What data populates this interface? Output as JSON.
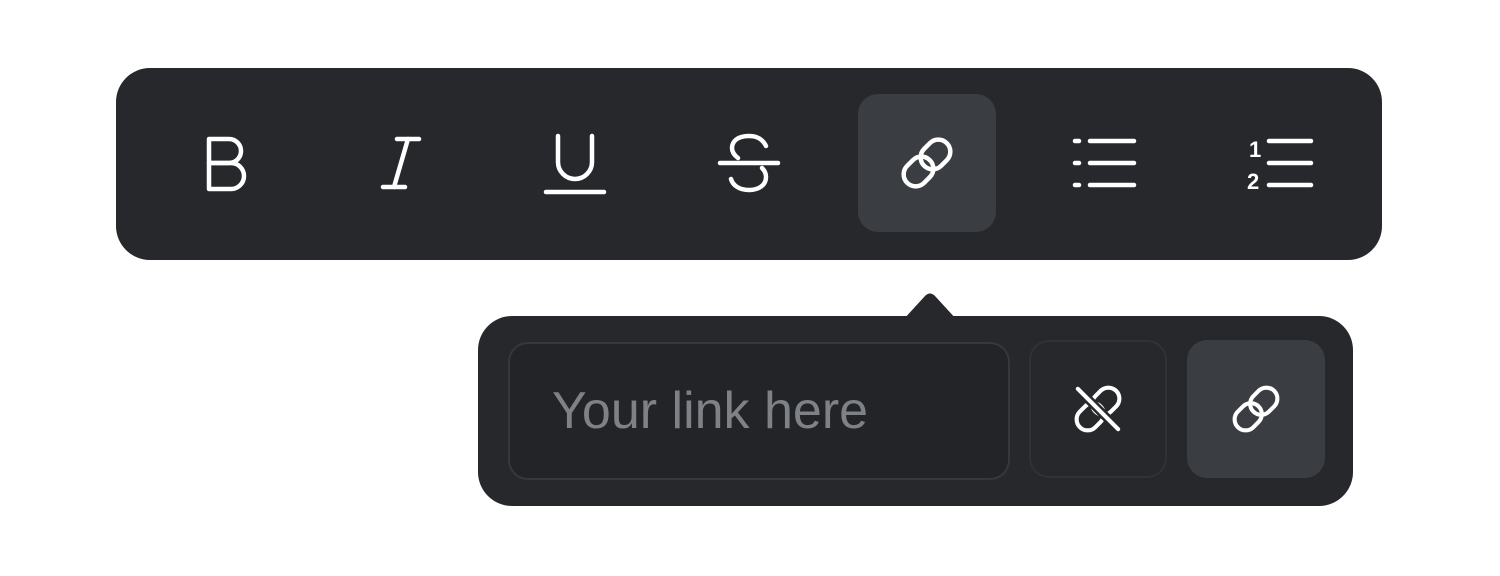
{
  "toolbar": {
    "buttons": [
      {
        "name": "bold",
        "icon": "bold-icon"
      },
      {
        "name": "italic",
        "icon": "italic-icon"
      },
      {
        "name": "underline",
        "icon": "underline-icon"
      },
      {
        "name": "strikethrough",
        "icon": "strikethrough-icon"
      },
      {
        "name": "link",
        "icon": "link-icon",
        "active": true
      },
      {
        "name": "bullet-list",
        "icon": "bullet-list-icon"
      },
      {
        "name": "numbered-list",
        "icon": "numbered-list-icon"
      }
    ],
    "numbered_list_digits": [
      "1",
      "2"
    ]
  },
  "link_popover": {
    "input": {
      "value": "",
      "placeholder": "Your link here"
    },
    "unlink_icon": "unlink-icon",
    "apply_icon": "link-icon"
  },
  "colors": {
    "toolbar_bg": "#26282c",
    "active_bg": "#3a3d41",
    "input_bg": "#222428",
    "icon": "#ffffff",
    "placeholder": "#7e8185"
  }
}
